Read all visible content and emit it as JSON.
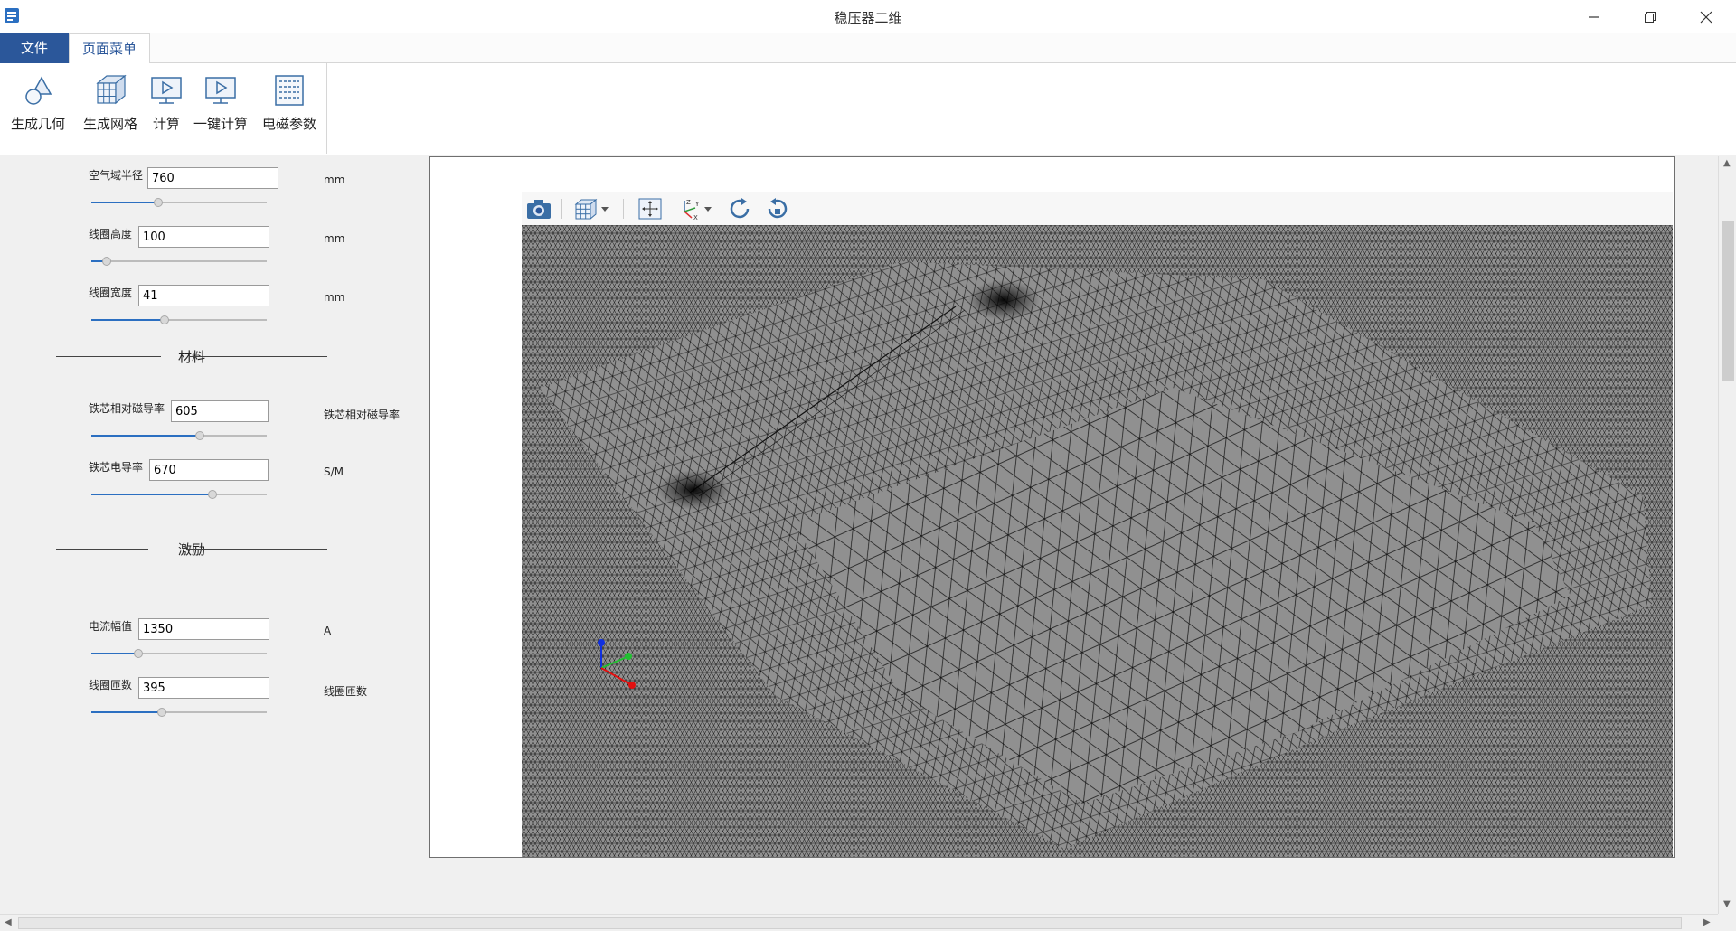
{
  "window": {
    "title": "稳压器二维"
  },
  "tabs": {
    "file": "文件",
    "page_menu": "页面菜单"
  },
  "ribbon": {
    "buttons": [
      {
        "label": "生成几何",
        "icon": "geometry-icon"
      },
      {
        "label": "生成网格",
        "icon": "mesh-cube-icon"
      },
      {
        "label": "计算",
        "icon": "monitor-play-icon"
      },
      {
        "label": "一键计算",
        "icon": "monitor-play-icon"
      },
      {
        "label": "电磁参数",
        "icon": "grid-table-icon"
      }
    ]
  },
  "params": {
    "air_radius": {
      "label": "空气域半径",
      "value": "760",
      "unit": "mm",
      "slider": 0.38
    },
    "coil_height": {
      "label": "线圈高度",
      "value": "100",
      "unit": "mm",
      "slider": 0.09
    },
    "coil_width": {
      "label": "线圈宽度",
      "value": "41",
      "unit": "mm",
      "slider": 0.42
    },
    "section_material": "材料",
    "core_permeability": {
      "label": "铁芯相对磁导率",
      "value": "605",
      "unit": "铁芯相对磁导率",
      "slider": 0.62
    },
    "core_conductivity": {
      "label": "铁芯电导率",
      "value": "670",
      "unit": "S/M",
      "slider": 0.69
    },
    "section_excitation": "激励",
    "current_amplitude": {
      "label": "电流幅值",
      "value": "1350",
      "unit": "A",
      "slider": 0.27
    },
    "coil_turns": {
      "label": "线圈匝数",
      "value": "395",
      "unit": "线圈匝数",
      "slider": 0.4
    }
  },
  "viewer_toolbar": [
    "camera-icon",
    "view-cube-icon",
    "fit-view-icon",
    "axes-icon",
    "rotate-cw-icon",
    "rotate-ccw-icon"
  ],
  "colors": {
    "accent": "#2b579a",
    "mesh_bg": "#909090",
    "mesh_line": "#111111"
  }
}
